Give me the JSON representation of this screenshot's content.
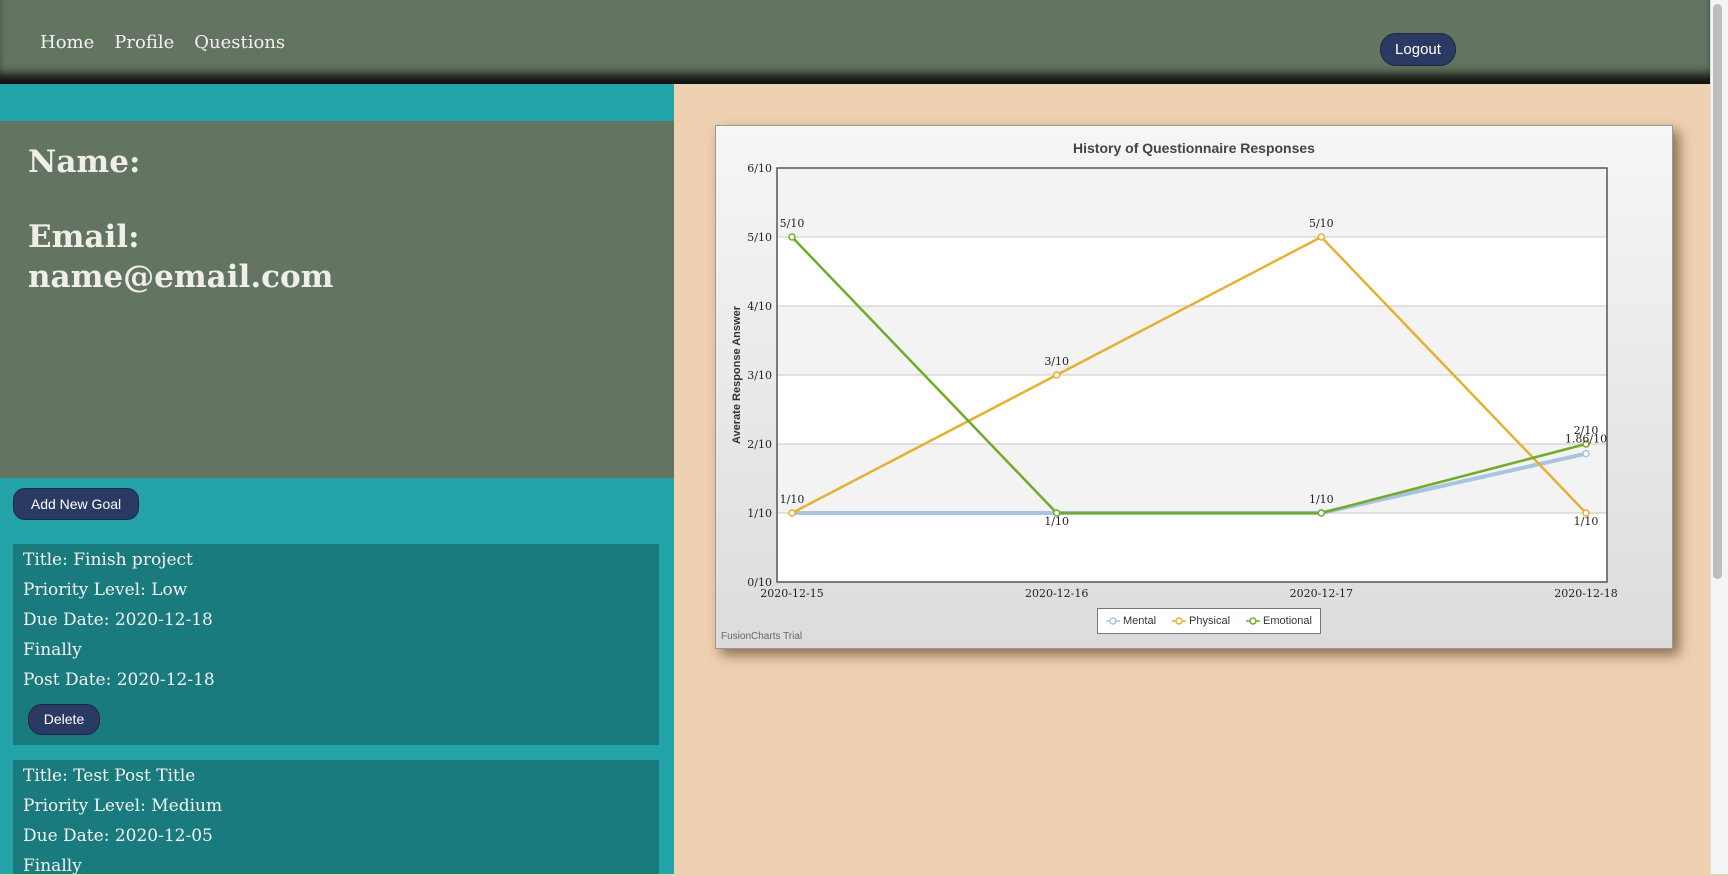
{
  "nav": {
    "links": [
      "Home",
      "Profile",
      "Questions"
    ],
    "logout_label": "Logout"
  },
  "profile": {
    "name_label": "Name:",
    "email_label": "Email:",
    "email": "name@email.com"
  },
  "goals": {
    "add_label": "Add New Goal",
    "delete_label": "Delete",
    "items": [
      {
        "title": "Title: Finish project",
        "priority": "Priority Level: Low",
        "due": "Due Date: 2020-12-18",
        "body": "Finally",
        "post": "Post Date: 2020-12-18"
      },
      {
        "title": "Title: Test Post Title",
        "priority": "Priority Level: Medium",
        "due": "Due Date: 2020-12-05",
        "body": "Finally"
      }
    ]
  },
  "chart_data": {
    "type": "line",
    "title": "History of Questionnaire Responses",
    "xlabel": "",
    "ylabel": "Averate Response Answer",
    "categories": [
      "2020-12-15",
      "2020-12-16",
      "2020-12-17",
      "2020-12-18"
    ],
    "ylim": [
      0,
      6
    ],
    "yticks": [
      "0/10",
      "1/10",
      "2/10",
      "3/10",
      "4/10",
      "5/10",
      "6/10"
    ],
    "grid": true,
    "legend_position": "bottom-center",
    "series": [
      {
        "name": "Mental",
        "values": [
          1,
          1,
          1,
          1.86
        ],
        "labels": [
          "",
          "",
          "",
          "1.86/10"
        ],
        "color": "#a9c4e0"
      },
      {
        "name": "Physical",
        "values": [
          1,
          3,
          5,
          1
        ],
        "labels": [
          "1/10",
          "3/10",
          "5/10",
          "1/10"
        ],
        "color": "#e6b032"
      },
      {
        "name": "Emotional",
        "values": [
          5,
          1,
          1,
          2
        ],
        "labels": [
          "5/10",
          "1/10",
          "1/10",
          "2/10"
        ],
        "color": "#72aa2a"
      }
    ],
    "footer": "FusionCharts Trial"
  }
}
